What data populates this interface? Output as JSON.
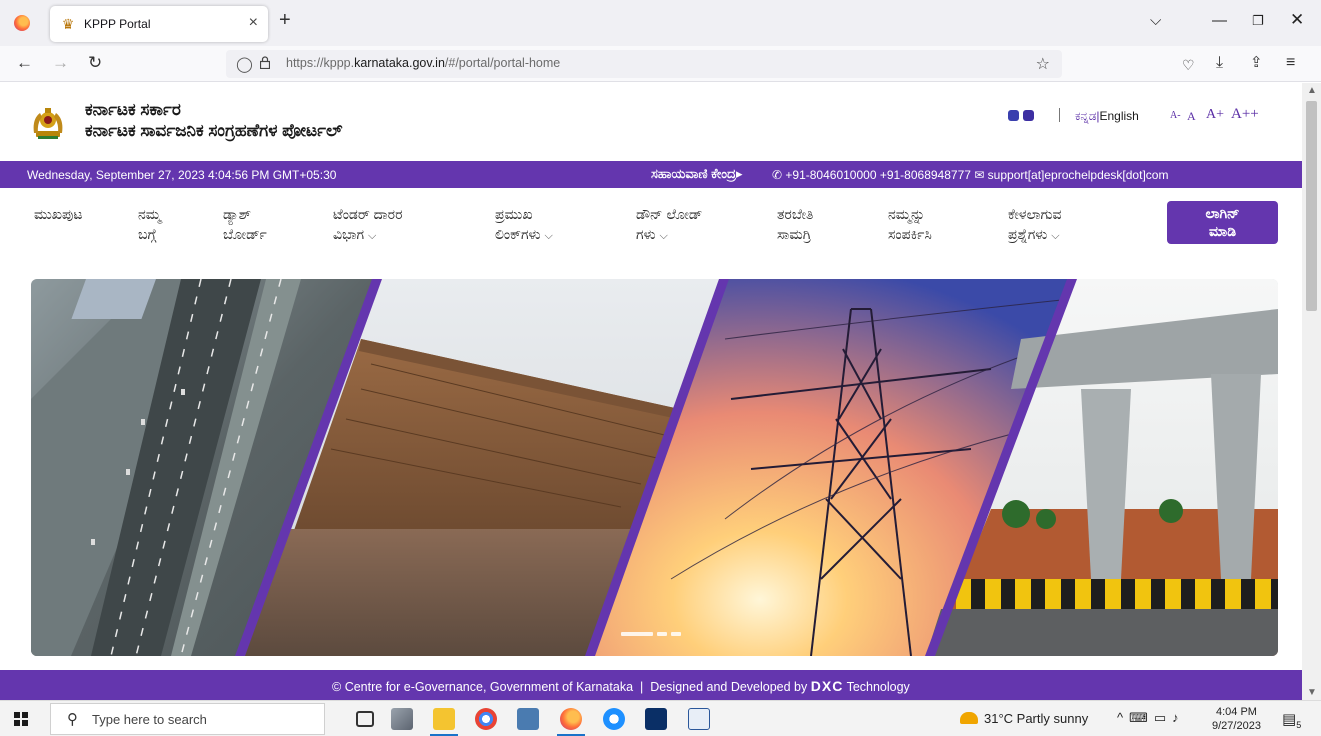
{
  "browser": {
    "tab_title": "KPPP Portal",
    "url_prefix": "https://kppp.",
    "url_domain": "karnataka.gov.in",
    "url_path": "/#/portal/portal-home"
  },
  "header": {
    "state_name": "ಕರ್ನಾಟಕ ಸರ್ಕಾರ",
    "portal_name": "ಕರ್ನಾಟಕ ಸಾರ್ವಜನಿಕ ಸಂಗ್ರಹಣೆಗಳ ಪೋರ್ಟಲ್",
    "lang_kannada": "ಕನ್ನಡ",
    "lang_separator": "|",
    "lang_english": "English",
    "font_sizes": [
      "A-",
      "A",
      "A+",
      "A++"
    ]
  },
  "infobar": {
    "datetime": "Wednesday, September 27, 2023 4:04:56 PM GMT+05:30",
    "helpline_label": "ಸಹಾಯವಾಣಿ ಕೇಂದ್ರ",
    "helpline_arrow": "▸",
    "phone_icon": "✆",
    "phones": "+91-8046010000 +91-8068948777",
    "mail_icon": "✉",
    "email": "support[at]eprochelpdesk[dot]com"
  },
  "menu": {
    "items": [
      {
        "line1": "ಮುಖಪುಟ",
        "line2": ""
      },
      {
        "line1": "ನಮ್ಮ",
        "line2": "ಬಗ್ಗೆ"
      },
      {
        "line1": "ಡ್ಯಾಶ್",
        "line2": "ಬೋರ್ಡ್"
      },
      {
        "line1": "ಟೆಂಡರ್ ದಾರರ",
        "line2": "ವಿಭಾಗ"
      },
      {
        "line1": "ಪ್ರಮುಖ",
        "line2": "ಲಿಂಕ್‌ಗಳು"
      },
      {
        "line1": "ಡೌನ್ ಲೋಡ್",
        "line2": "ಗಳು"
      },
      {
        "line1": "ತರಬೇತಿ",
        "line2": "ಸಾಮಗ್ರಿ"
      },
      {
        "line1": "ನಮ್ಮನ್ನು",
        "line2": "ಸಂಪರ್ಕಿಸಿ"
      },
      {
        "line1": "ಕೇಳಲಾಗುವ",
        "line2": "ಪ್ರಶ್ನೆಗಳು"
      }
    ],
    "login_line1": "ಲಾಗಿನ್",
    "login_line2": "ಮಾಡಿ"
  },
  "carousel": {
    "panels": [
      "highway",
      "dam",
      "power-tower",
      "flyover-bridge"
    ],
    "slide_count": 3,
    "active_slide": 1
  },
  "footer": {
    "copyright_symbol": "©",
    "org": "Centre for e-Governance, Government of Karnataka",
    "separator": "|",
    "designed_by": "Designed and Developed by",
    "dxc": "DXC",
    "technology": "Technology"
  },
  "taskbar": {
    "search_placeholder": "Type here to search",
    "weather": "31°C  Partly sunny",
    "time": "4:04 PM",
    "date": "9/27/2023",
    "notification_count": "5"
  },
  "colors": {
    "brand_purple": "#6436ae",
    "theme_dot": "#3a3fae"
  }
}
